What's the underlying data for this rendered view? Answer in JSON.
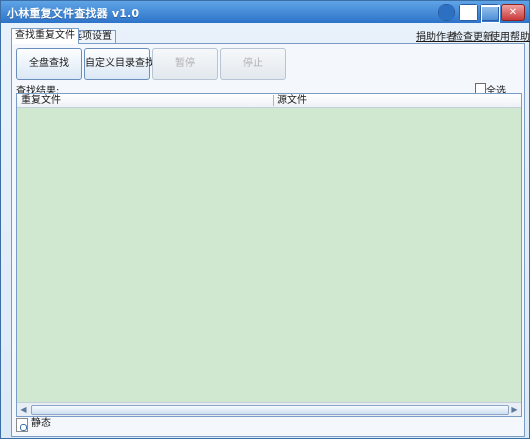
{
  "window": {
    "title": "小林重复文件查找器 v1.0"
  },
  "tabs": [
    {
      "label": "查找重复文件"
    },
    {
      "label": "选项设置"
    }
  ],
  "links": [
    {
      "label": "捐助作者"
    },
    {
      "label": "检查更新"
    },
    {
      "label": "使用帮助"
    }
  ],
  "buttons": {
    "full_search": "全盘查找",
    "custom_dir_search": "自定义目录查找",
    "pause": "暂停",
    "stop": "停止"
  },
  "results": {
    "label": "查找结果:",
    "select_all_label": "全选",
    "columns": [
      "重复文件",
      "源文件"
    ],
    "rows": []
  },
  "status": {
    "text": "静态"
  },
  "icons": {
    "user": "user-icon",
    "minimize": "minimize-icon",
    "maximize": "maximize-icon",
    "close": "close-icon",
    "status": "magnifier-document-icon",
    "scroll_left": "scroll-left-icon",
    "scroll_right": "scroll-right-icon"
  },
  "colors": {
    "title_bar": "#2d73c9",
    "list_background": "#d0e8cf",
    "window_background": "#dce9f6"
  }
}
